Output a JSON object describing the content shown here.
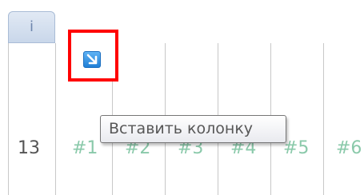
{
  "header": {
    "info_tab_label": "i"
  },
  "row": {
    "number": "13"
  },
  "columns": [
    "#1",
    "#2",
    "#3",
    "#4",
    "#5",
    "#6"
  ],
  "insert_button": {
    "icon": "arrow-down-right-icon"
  },
  "tooltip": {
    "text": "Вставить колонку"
  },
  "colors": {
    "highlight_border": "#ff0000",
    "column_label": "#8ac9aa",
    "icon_blue": "#2b8ae0",
    "grid_line": "#c8c8c8"
  }
}
